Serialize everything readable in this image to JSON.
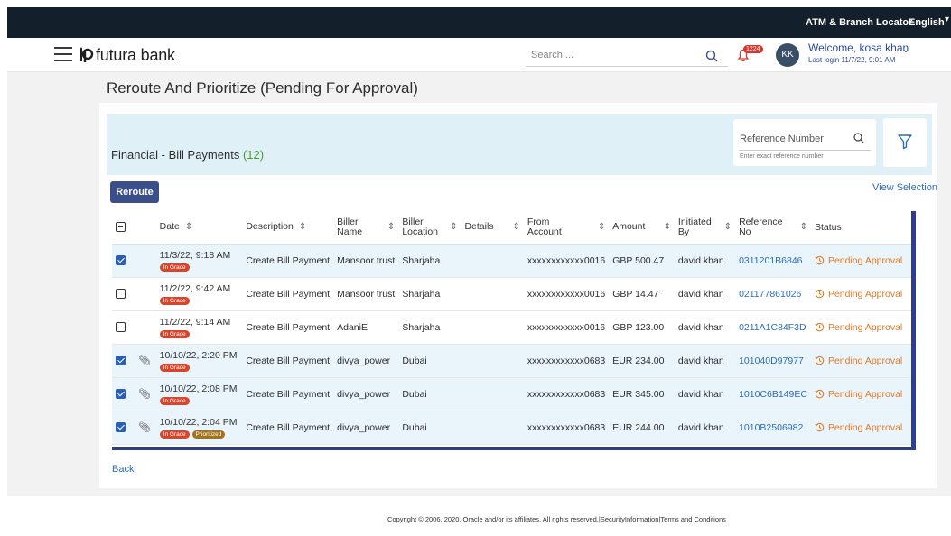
{
  "topbar": {
    "atm_label": "ATM & Branch Locator",
    "language": "English"
  },
  "header": {
    "brand": "futura bank",
    "search_placeholder": "Search ...",
    "notification_count": "1224",
    "avatar_initials": "KK",
    "welcome": "Welcome, kosa khan",
    "last_login": "Last login 11/7/22, 9:01 AM"
  },
  "page": {
    "title": "Reroute And Prioritize (Pending For Approval)"
  },
  "filter": {
    "section_title": "Financial - Bill Payments",
    "count": "(12)",
    "ref_label": "Reference Number",
    "ref_hint": "Enter exact reference number"
  },
  "actions": {
    "reroute": "Reroute",
    "view_selection": "View Selection",
    "back": "Back"
  },
  "table": {
    "headers": {
      "date": "Date",
      "description": "Description",
      "biller_name": "Biller Name",
      "biller_location": "Biller Location",
      "details": "Details",
      "from_account": "From Account",
      "amount": "Amount",
      "initiated_by": "Initiated By",
      "reference_no": "Reference No",
      "status": "Status"
    },
    "tags": {
      "grace": "In Grace",
      "prioritized": "Prioritized"
    },
    "rows": [
      {
        "checked": true,
        "attachment": false,
        "date": "11/3/22, 9:18 AM",
        "prioritized": false,
        "description": "Create Bill Payment",
        "biller_name": "Mansoor trust",
        "biller_location": "Sharjaha",
        "details": "",
        "from_account": "xxxxxxxxxxxx0016",
        "amount": "GBP 500.47",
        "initiated_by": "david khan",
        "reference_no": "0311201B6846",
        "status": "Pending Approval"
      },
      {
        "checked": false,
        "attachment": false,
        "date": "11/2/22, 9:42 AM",
        "prioritized": false,
        "description": "Create Bill Payment",
        "biller_name": "Mansoor trust",
        "biller_location": "Sharjaha",
        "details": "",
        "from_account": "xxxxxxxxxxxx0016",
        "amount": "GBP 14.47",
        "initiated_by": "david khan",
        "reference_no": "021177861026",
        "status": "Pending Approval"
      },
      {
        "checked": false,
        "attachment": false,
        "date": "11/2/22, 9:14 AM",
        "prioritized": false,
        "description": "Create Bill Payment",
        "biller_name": "AdaniE",
        "biller_location": "Sharjaha",
        "details": "",
        "from_account": "xxxxxxxxxxxx0016",
        "amount": "GBP 123.00",
        "initiated_by": "david khan",
        "reference_no": "0211A1C84F3D",
        "status": "Pending Approval"
      },
      {
        "checked": true,
        "attachment": true,
        "date": "10/10/22, 2:20 PM",
        "prioritized": false,
        "description": "Create Bill Payment",
        "biller_name": "divya_power",
        "biller_location": "Dubai",
        "details": "",
        "from_account": "xxxxxxxxxxxx0683",
        "amount": "EUR 234.00",
        "initiated_by": "david khan",
        "reference_no": "101040D97977",
        "status": "Pending Approval"
      },
      {
        "checked": true,
        "attachment": true,
        "date": "10/10/22, 2:08 PM",
        "prioritized": false,
        "description": "Create Bill Payment",
        "biller_name": "divya_power",
        "biller_location": "Dubai",
        "details": "",
        "from_account": "xxxxxxxxxxxx0683",
        "amount": "EUR 345.00",
        "initiated_by": "david khan",
        "reference_no": "1010C6B149EC",
        "status": "Pending Approval"
      },
      {
        "checked": true,
        "attachment": true,
        "date": "10/10/22, 2:04 PM",
        "prioritized": true,
        "description": "Create Bill Payment",
        "biller_name": "divya_power",
        "biller_location": "Dubai",
        "details": "",
        "from_account": "xxxxxxxxxxxx0683",
        "amount": "EUR 244.00",
        "initiated_by": "david khan",
        "reference_no": "1010B2506982",
        "status": "Pending Approval"
      }
    ]
  },
  "footer": {
    "copyright": "Copyright © 2006, 2020, Oracle and/or its affiliates. All rights reserved.|SecurityInformation|Terms and Conditions"
  },
  "colors": {
    "topbar": "#131f2a",
    "primary_button": "#3a4e8c",
    "link": "#2c6db5",
    "status": "#e07a27",
    "grace_tag": "#d6452c",
    "prioritized_tag": "#a5731a",
    "count": "#4a9a35",
    "filter_band": "#dff1f7"
  },
  "icons": [
    "hamburger-icon",
    "brand-logo-icon",
    "search-icon",
    "bell-icon",
    "chevron-down-icon",
    "filter-icon",
    "sort-icon",
    "attachment-icon",
    "clock-icon",
    "checkbox-icon"
  ]
}
